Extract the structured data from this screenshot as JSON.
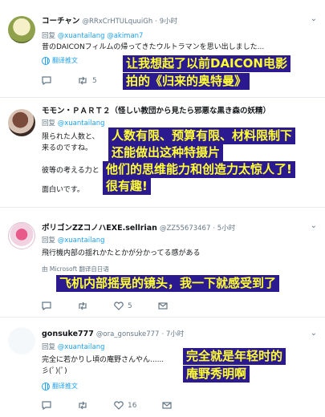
{
  "tweets": [
    {
      "name": "コーチャン",
      "handle": "@RRxCrHTULquuiGh",
      "time": "· 9小时",
      "reply_prefix": "回复",
      "mentions": "@xuantailang @akiman7",
      "text": "昔のDAICONフィルムの帰ってきたウルトラマンを思い出しました...",
      "translate": "翻译推文",
      "retweets": "5",
      "likes": "",
      "caption_lines": [
        "让我想起了以前DAICON电影",
        "拍的《归来的奥特曼》"
      ]
    },
    {
      "name": "モモン・ＰＡＲＴ２（怪しい教団から見たら邪悪な黒き森の妖精）",
      "reply_prefix": "回复",
      "mentions": "@xuantailang",
      "text_lines": [
        "限られた人数と、",
        "来るのですね。",
        "彼等の考える力と",
        "面白いです。"
      ],
      "caption_lines": [
        "人数有限、预算有限、材料限制下",
        "还能做出这种特摄片",
        "他们的思维能力和创造力太惊人了!",
        "很有趣!"
      ]
    },
    {
      "name": "ポリゴンZZコノハEXE.sellrian",
      "handle": "@ZZ55673467",
      "time": "· 5小时",
      "reply_prefix": "回复",
      "mentions": "@xuantailang",
      "text": "飛行機内部の揺れかたとかが分かってる感がある",
      "translate_partial": "由 Microsoft 翻译自日语",
      "likes": "5",
      "caption_lines": [
        "飞机内部摇晃的镜头，我一下就感受到了"
      ]
    },
    {
      "name": "gonsuke777",
      "handle": "@ora_gonsuke777",
      "time": "· 7小时",
      "reply_prefix": "回复",
      "mentions": "@xuantailang",
      "text_lines": [
        "完全に若かりし頃の庵野さんやん......",
        "彡(ﾟ)(ﾟ)"
      ],
      "translate": "翻译推文",
      "likes": "16",
      "caption_lines": [
        "完全就是年轻时的",
        "庵野秀明啊"
      ]
    }
  ]
}
